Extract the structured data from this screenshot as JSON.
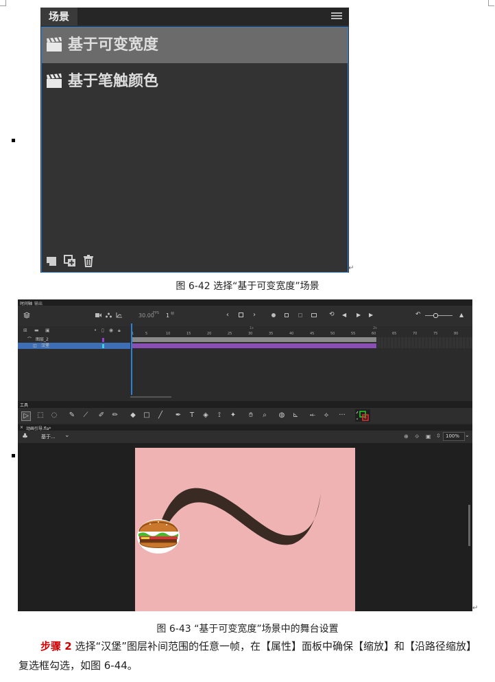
{
  "scenes_panel": {
    "tab_title": "场景",
    "scenes": [
      {
        "name": "基于可变宽度",
        "selected": true
      },
      {
        "name": "基于笔触颜色",
        "selected": false
      }
    ],
    "icons": [
      "menu-icon",
      "clapperboard-icon",
      "add-scene-icon",
      "duplicate-scene-icon",
      "trash-icon"
    ],
    "selection_color": "#2f7fd4"
  },
  "figure_42_caption": "图 6-42 选择“基于可变宽度”场景",
  "animate": {
    "panel_tabs": [
      "时间轴",
      "输出"
    ],
    "fps": "30.00",
    "fps_unit": "FPS",
    "current_frame": "1",
    "frame_unit": "帧",
    "ruler_seconds": [
      "1s",
      "2s"
    ],
    "ruler_ticks": [
      "1",
      "5",
      "10",
      "15",
      "20",
      "25",
      "30",
      "35",
      "40",
      "45",
      "50",
      "55",
      "60",
      "65",
      "70",
      "75",
      "80"
    ],
    "layers": [
      {
        "name": "图层_2",
        "color": "#9b3fd1",
        "selected": false
      },
      {
        "name": "汉堡",
        "color": "#3fd1e0",
        "selected": true
      }
    ],
    "tools_title": "工具",
    "doc_tab": "动画引导.fla*",
    "scene_selector": "基于...",
    "zoom": "100%",
    "stage_color": "#f0b3b3",
    "path_color": "#3a2a24"
  },
  "figure_43_caption": "图 6-43 “基于可变宽度”场景中的舞台设置",
  "paragraph": {
    "step_label": "步骤 2",
    "text": " 选择“汉堡”图层补间范围的任意一帧，在【属性】面板中确保【缩放】和【沿路径缩放】复选框勾选，如图 6-44。"
  }
}
